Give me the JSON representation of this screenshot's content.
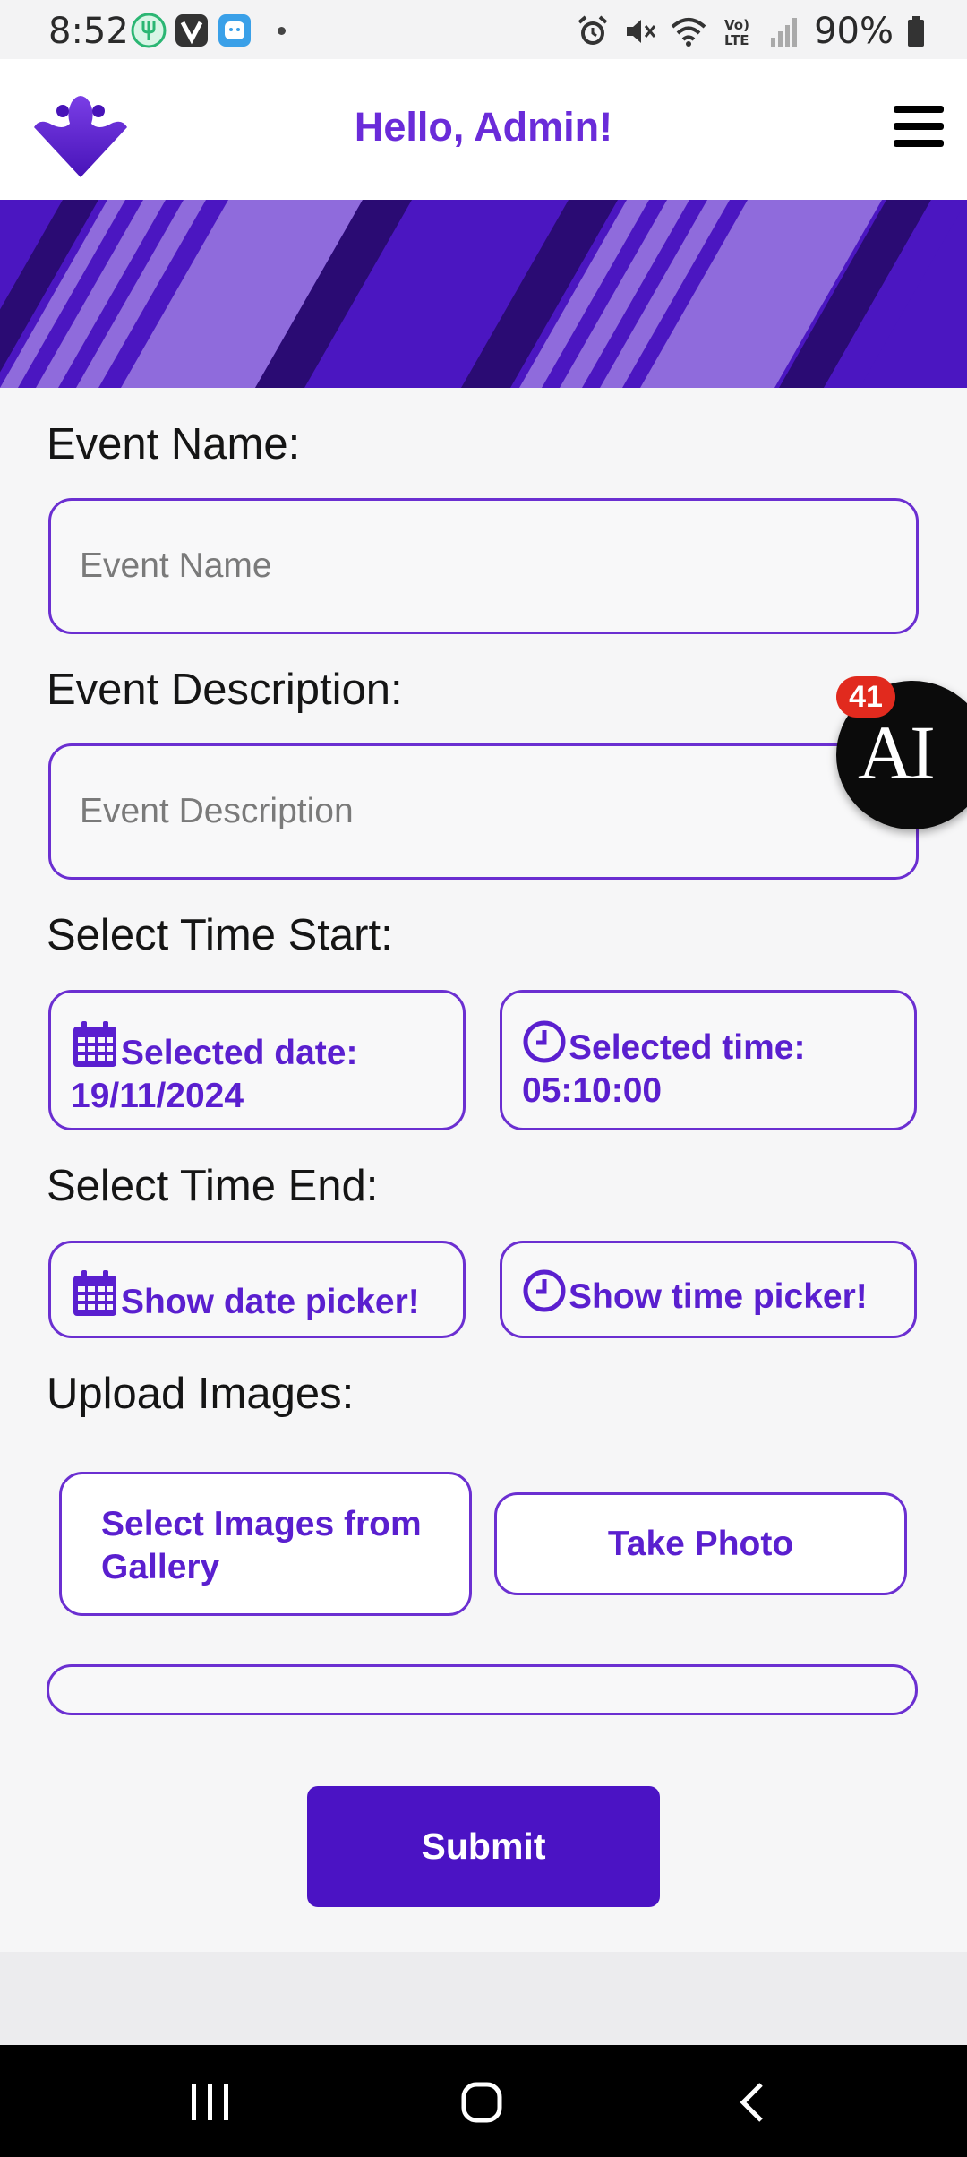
{
  "status_bar": {
    "time": "8:52",
    "battery": "90%",
    "icons": [
      "fork-leaf-app-icon",
      "v-app-icon",
      "face-app-icon",
      "alarm-icon",
      "mute-icon",
      "wifi-icon",
      "volte-icon",
      "signal-icon",
      "battery-icon"
    ]
  },
  "header": {
    "greeting": "Hello, Admin!",
    "menu_icon": "hamburger-menu-icon"
  },
  "form": {
    "event_name_label": "Event Name:",
    "event_name_placeholder": "Event Name",
    "event_description_label": "Event Description:",
    "event_description_placeholder": "Event Description",
    "time_start_label": "Select Time Start:",
    "start_date_text": "Selected date: 19/11/2024",
    "start_date_line1": "Selected date:",
    "start_date_line2": "19/11/2024",
    "start_time_line1": "Selected time:",
    "start_time_line2": "05:10:00",
    "time_end_label": "Select Time End:",
    "end_date_button": "Show date picker!",
    "end_time_button": "Show time picker!",
    "upload_label": "Upload Images:",
    "gallery_button_line1": "Select Images from",
    "gallery_button_line2": "Gallery",
    "take_photo_button": "Take Photo",
    "submit_button": "Submit"
  },
  "ai_widget": {
    "label": "AI",
    "badge_count": "41"
  },
  "colors": {
    "brand_purple": "#6b2fd1",
    "submit_purple": "#4b13c4",
    "badge_red": "#e12a1e"
  }
}
